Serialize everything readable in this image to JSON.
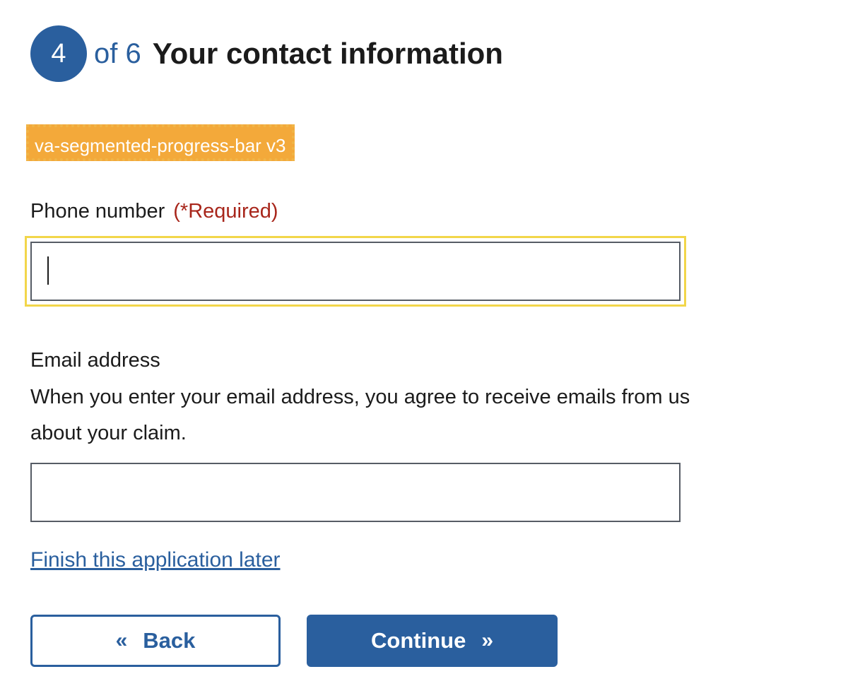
{
  "step": {
    "number": "4",
    "of_text": "of 6",
    "title": "Your contact information"
  },
  "component_badge": "va-segmented-progress-bar v3",
  "phone": {
    "label": "Phone number",
    "required": "(*Required)",
    "value": ""
  },
  "email": {
    "label": "Email address",
    "hint": "When you enter your email address, you agree to receive emails from us about your claim.",
    "value": ""
  },
  "links": {
    "finish_later": "Finish this application later"
  },
  "buttons": {
    "back": "Back",
    "continue": "Continue",
    "back_icon": "chevron-double-left-icon",
    "continue_icon": "chevron-double-right-icon"
  },
  "colors": {
    "primary": "#2a5f9e",
    "required": "#a8261b",
    "focus": "#f2d64a",
    "badge": "#f3a93a"
  }
}
